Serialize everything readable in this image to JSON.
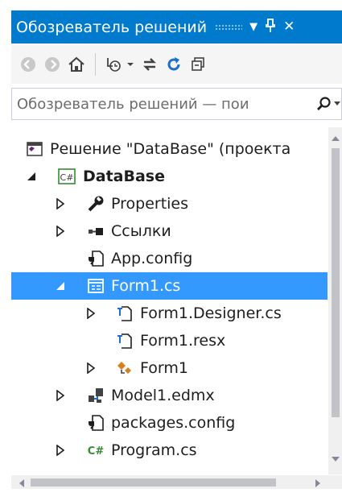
{
  "window": {
    "title": "Обозреватель решений",
    "buttons": {
      "dropdown": "▼",
      "pin": "Ҏ",
      "close": "✕"
    }
  },
  "toolbar": {
    "items": [
      "back-icon",
      "forward-icon",
      "home-icon",
      "pending-changes-icon",
      "sync-icon",
      "refresh-icon",
      "collapse-all-icon"
    ]
  },
  "search": {
    "placeholder": "Обозреватель решений — пои"
  },
  "tree": {
    "items": [
      {
        "label": "Решение \"DataBase\" (проекта"
      },
      {
        "label": "DataBase"
      },
      {
        "label": "Properties"
      },
      {
        "label": "Ссылки"
      },
      {
        "label": "App.config"
      },
      {
        "label": "Form1.cs"
      },
      {
        "label": "Form1.Designer.cs"
      },
      {
        "label": "Form1.resx"
      },
      {
        "label": "Form1"
      },
      {
        "label": "Model1.edmx"
      },
      {
        "label": "packages.config"
      },
      {
        "label": "Program.cs"
      }
    ],
    "selected": "Form1.cs"
  },
  "colors": {
    "accent": "#007acc",
    "selection": "#3399ff",
    "csharp": "#388a34",
    "icon_dark": "#424242"
  }
}
